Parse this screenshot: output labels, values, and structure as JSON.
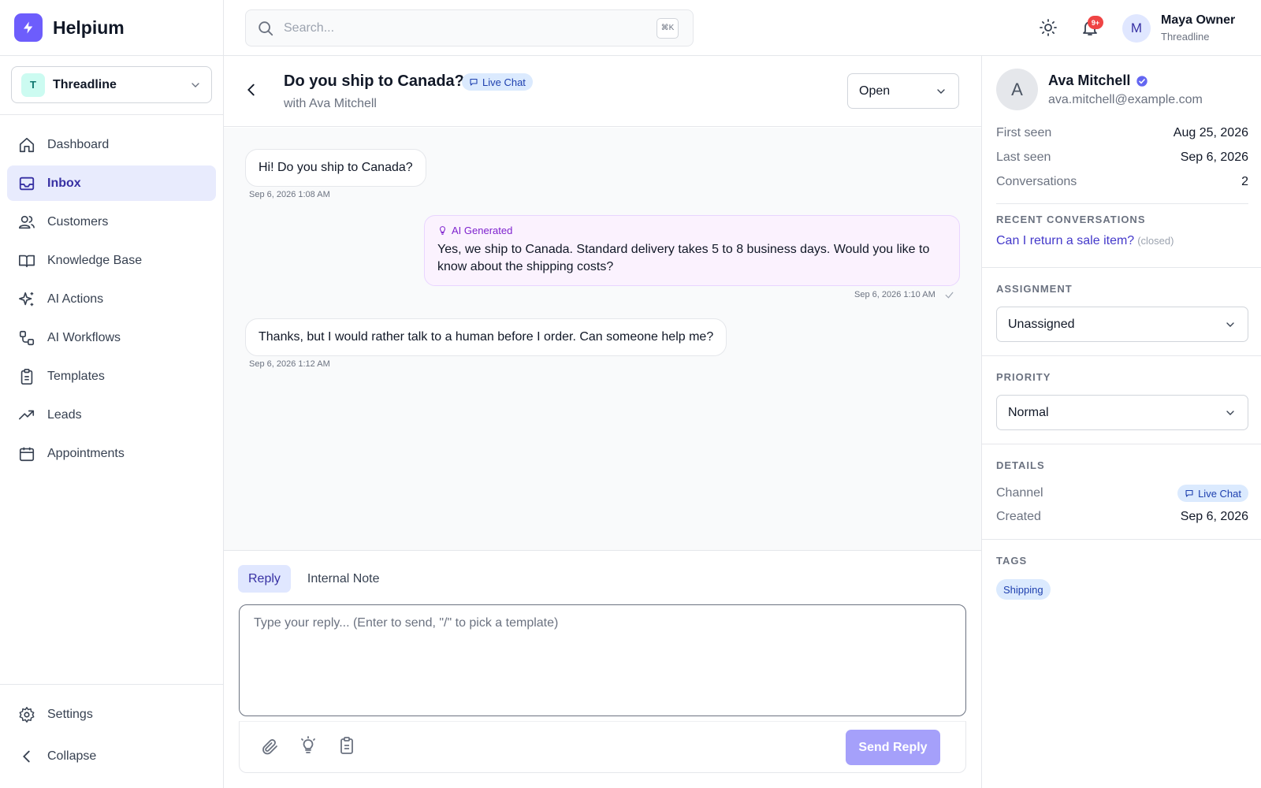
{
  "app": {
    "name": "Helpium"
  },
  "org": {
    "initial": "T",
    "name": "Threadline"
  },
  "nav": {
    "items": [
      {
        "label": "Dashboard"
      },
      {
        "label": "Inbox"
      },
      {
        "label": "Customers"
      },
      {
        "label": "Knowledge Base"
      },
      {
        "label": "AI Actions"
      },
      {
        "label": "AI Workflows"
      },
      {
        "label": "Templates"
      },
      {
        "label": "Leads"
      },
      {
        "label": "Appointments"
      }
    ],
    "settings": "Settings",
    "collapse": "Collapse"
  },
  "search": {
    "placeholder": "Search...",
    "shortcut": "⌘K"
  },
  "user": {
    "initial": "M",
    "name": "Maya Owner",
    "org": "Threadline",
    "notifications": "9+"
  },
  "conversation": {
    "title": "Do you ship to Canada?",
    "channel": "Live Chat",
    "subtitle": "with Ava Mitchell",
    "status": "Open",
    "messages": [
      {
        "text": "Hi! Do you ship to Canada?",
        "time": "Sep 6, 2026 1:08 AM"
      },
      {
        "label": "AI Generated",
        "text": "Yes, we ship to Canada. Standard delivery takes 5 to 8 business days. Would you like to know about the shipping costs?",
        "time": "Sep 6, 2026 1:10 AM"
      },
      {
        "text": "Thanks, but I would rather talk to a human before I order. Can someone help me?",
        "time": "Sep 6, 2026 1:12 AM"
      }
    ]
  },
  "composer": {
    "tabs": [
      "Reply",
      "Internal Note"
    ],
    "placeholder": "Type your reply... (Enter to send, \"/\" to pick a template)",
    "send": "Send Reply"
  },
  "customer": {
    "initial": "A",
    "name": "Ava Mitchell",
    "email": "ava.mitchell@example.com",
    "first_seen_label": "First seen",
    "first_seen": "Aug 25, 2026",
    "last_seen_label": "Last seen",
    "last_seen": "Sep 6, 2026",
    "conversations_label": "Conversations",
    "conversations": "2",
    "recent_heading": "RECENT CONVERSATIONS",
    "recent": {
      "title": "Can I return a sale item?",
      "status": "(closed)"
    }
  },
  "assignment": {
    "heading": "ASSIGNMENT",
    "value": "Unassigned"
  },
  "priority": {
    "heading": "PRIORITY",
    "value": "Normal"
  },
  "details": {
    "heading": "DETAILS",
    "channel_label": "Channel",
    "channel": "Live Chat",
    "created_label": "Created",
    "created": "Sep 6, 2026"
  },
  "tags": {
    "heading": "TAGS",
    "items": [
      "Shipping"
    ]
  },
  "colors": {
    "accent": "#6d5dfc",
    "active_bg": "#e8ebfd",
    "ai_bg": "#fbf2fe",
    "badge": "#ef4444"
  }
}
